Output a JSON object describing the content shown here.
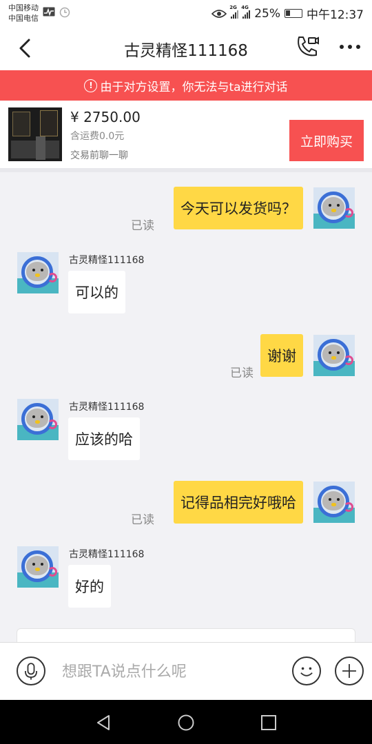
{
  "status_bar": {
    "carrier_1": "中国移动",
    "carrier_2": "中国电信",
    "net_1": "2G",
    "net_2": "4G",
    "battery": "25%",
    "time": "中午12:37",
    "icons": [
      "activity-icon",
      "sync-icon",
      "eye-icon",
      "signal-icon",
      "battery-icon"
    ]
  },
  "header": {
    "title": "古灵精怪111168",
    "icons": [
      "back-arrow-icon",
      "video-call-icon",
      "more-icon"
    ]
  },
  "banner": {
    "icon": "!",
    "text": "由于对方设置，你无法与ta进行对话",
    "color": "#f75151"
  },
  "product": {
    "price": "¥ 2750.00",
    "shipping": "含运费0.0元",
    "note": "交易前聊一聊",
    "buy_label": "立即购买"
  },
  "messages": [
    {
      "from": "me",
      "text": "今天可以发货吗？",
      "status": "已读"
    },
    {
      "from": "them",
      "sender": "古灵精怪111168",
      "text": "可以的"
    },
    {
      "from": "me",
      "text": "谢谢",
      "status": "已读"
    },
    {
      "from": "them",
      "sender": "古灵精怪111168",
      "text": "应该的哈"
    },
    {
      "from": "me",
      "text": "记得品相完好哦哈",
      "status": "已读"
    },
    {
      "from": "them",
      "sender": "古灵精怪111168",
      "text": "好的"
    }
  ],
  "input_bar": {
    "placeholder": "想跟TA说点什么呢",
    "icons": [
      "microphone-icon",
      "emoji-icon",
      "plus-icon"
    ]
  },
  "nav_bar": {
    "icons": [
      "nav-back-icon",
      "nav-home-icon",
      "nav-recents-icon"
    ]
  },
  "colors": {
    "accent": "#f75151",
    "my_bubble": "#ffd845",
    "their_bubble": "#ffffff",
    "chat_background": "#f2f2f5"
  }
}
